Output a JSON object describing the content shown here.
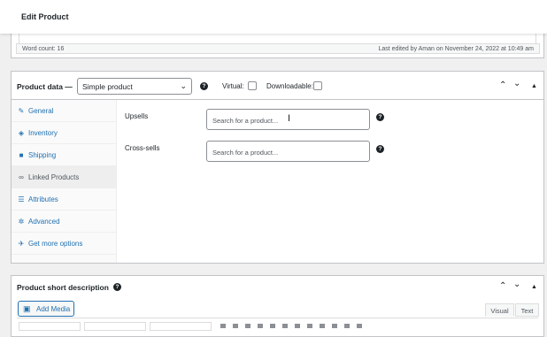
{
  "header": {
    "title": "Edit Product"
  },
  "editor_status": {
    "word_count": "Word count: 16",
    "last_edited": "Last edited by Aman on November 24, 2022 at 10:49 am"
  },
  "product_data": {
    "title": "Product data —",
    "product_type": "Simple product",
    "virtual_label": "Virtual:",
    "downloadable_label": "Downloadable:",
    "virtual_checked": false,
    "downloadable_checked": false,
    "tabs": [
      {
        "label": "General",
        "icon": "wrench-icon"
      },
      {
        "label": "Inventory",
        "icon": "tag-icon"
      },
      {
        "label": "Shipping",
        "icon": "truck-icon"
      },
      {
        "label": "Linked Products",
        "icon": "link-icon",
        "active": true
      },
      {
        "label": "Attributes",
        "icon": "list-icon"
      },
      {
        "label": "Advanced",
        "icon": "gear-icon"
      },
      {
        "label": "Get more options",
        "icon": "plugin-icon"
      }
    ],
    "linked": {
      "upsells_label": "Upsells",
      "upsells_placeholder": "Search for a product...",
      "crosssells_label": "Cross-sells",
      "crosssells_placeholder": "Search for a product..."
    }
  },
  "short_description": {
    "title": "Product short description",
    "add_media": "Add Media",
    "tab_visual": "Visual",
    "tab_text": "Text"
  },
  "icons": {
    "help": "?",
    "chevron_down": "⌄",
    "move_up": "⌃",
    "move_down": "⌄",
    "toggle": "▲"
  },
  "colors": {
    "accent": "#2271b1",
    "text": "#1d2327",
    "border": "#c3c4c7"
  }
}
